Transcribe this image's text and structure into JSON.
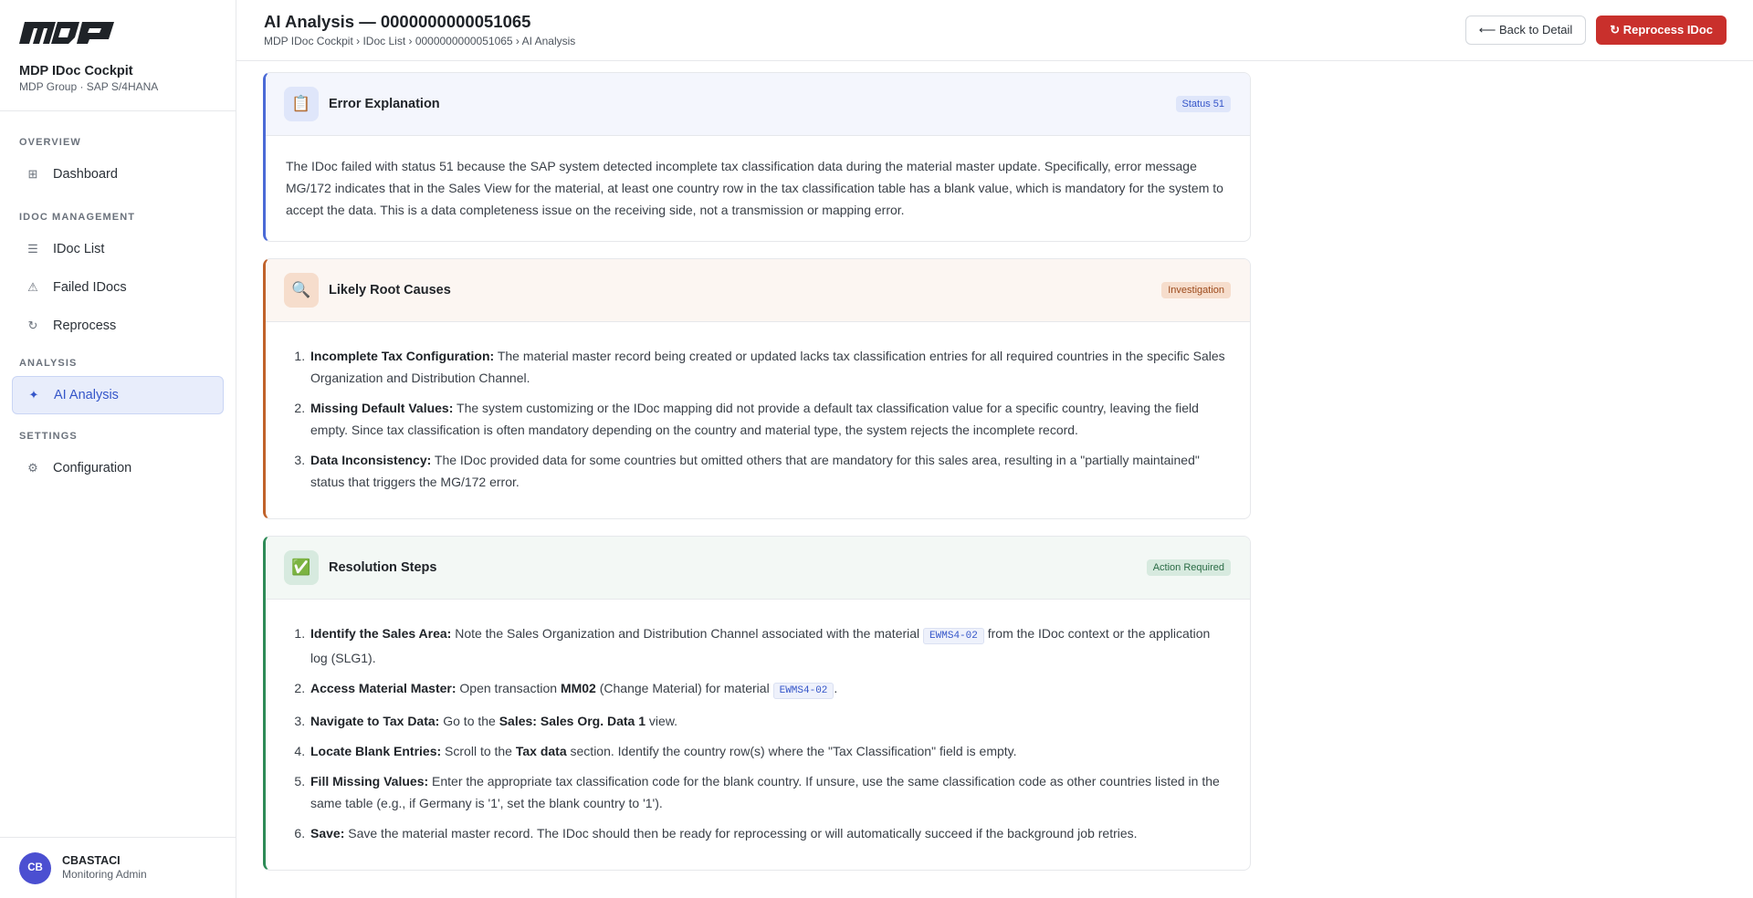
{
  "sidebar": {
    "brand_title": "MDP IDoc Cockpit",
    "brand_sub": "MDP Group · SAP S/4HANA",
    "sections": [
      {
        "label": "OVERVIEW",
        "items": [
          {
            "label": "Dashboard",
            "icon": "grid-icon"
          }
        ]
      },
      {
        "label": "IDOC MANAGEMENT",
        "items": [
          {
            "label": "IDoc List",
            "icon": "list-icon"
          },
          {
            "label": "Failed IDocs",
            "icon": "warning-icon"
          },
          {
            "label": "Reprocess",
            "icon": "refresh-icon"
          }
        ]
      },
      {
        "label": "ANALYSIS",
        "items": [
          {
            "label": "AI Analysis",
            "icon": "sparkle-icon"
          }
        ]
      },
      {
        "label": "SETTINGS",
        "items": [
          {
            "label": "Configuration",
            "icon": "gear-icon"
          }
        ]
      }
    ],
    "user": {
      "initials": "CB",
      "name": "CBASTACI",
      "role": "Monitoring Admin"
    }
  },
  "header": {
    "title": "AI Analysis — 0000000000051065",
    "breadcrumb": "MDP IDoc Cockpit › IDoc List › 0000000000051065 › AI Analysis",
    "back_label": "⟵ Back to Detail",
    "reprocess_label": "↻ Reprocess IDoc"
  },
  "cards": {
    "explanation": {
      "title": "Error Explanation",
      "badge": "Status 51",
      "body": "The IDoc failed with status 51 because the SAP system detected incomplete tax classification data during the material master update. Specifically, error message MG/172 indicates that in the Sales View for the material, at least one country row in the tax classification table has a blank value, which is mandatory for the system to accept the data. This is a data completeness issue on the receiving side, not a transmission or mapping error."
    },
    "root_causes": {
      "title": "Likely Root Causes",
      "badge": "Investigation",
      "items": [
        {
          "bold": "Incomplete Tax Configuration:",
          "text": " The material master record being created or updated lacks tax classification entries for all required countries in the specific Sales Organization and Distribution Channel."
        },
        {
          "bold": "Missing Default Values:",
          "text": " The system customizing or the IDoc mapping did not provide a default tax classification value for a specific country, leaving the field empty. Since tax classification is often mandatory depending on the country and material type, the system rejects the incomplete record."
        },
        {
          "bold": "Data Inconsistency:",
          "text": " The IDoc provided data for some countries but omitted others that are mandatory for this sales area, resulting in a \"partially maintained\" status that triggers the MG/172 error."
        }
      ]
    },
    "resolution": {
      "title": "Resolution Steps",
      "badge": "Action Required",
      "step1": {
        "bold": "Identify the Sales Area:",
        "t1": " Note the Sales Organization and Distribution Channel associated with the material ",
        "code": "EWMS4-02",
        "t2": " from the IDoc context or the application log (SLG1)."
      },
      "step2": {
        "bold": "Access Material Master:",
        "t1": " Open transaction ",
        "b2": "MM02",
        "t2": " (Change Material) for material ",
        "code": "EWMS4-02",
        "t3": "."
      },
      "step3": {
        "bold": "Navigate to Tax Data:",
        "t1": " Go to the ",
        "b2": "Sales: Sales Org. Data 1",
        "t2": " view."
      },
      "step4": {
        "bold": "Locate Blank Entries:",
        "t1": " Scroll to the ",
        "b2": "Tax data",
        "t2": " section. Identify the country row(s) where the \"Tax Classification\" field is empty."
      },
      "step5": {
        "bold": "Fill Missing Values:",
        "t1": " Enter the appropriate tax classification code for the blank country. If unsure, use the same classification code as other countries listed in the same table (e.g., if Germany is '1', set the blank country to '1')."
      },
      "step6": {
        "bold": "Save:",
        "t1": " Save the material master record. The IDoc should then be ready for reprocessing or will automatically succeed if the background job retries."
      }
    }
  }
}
